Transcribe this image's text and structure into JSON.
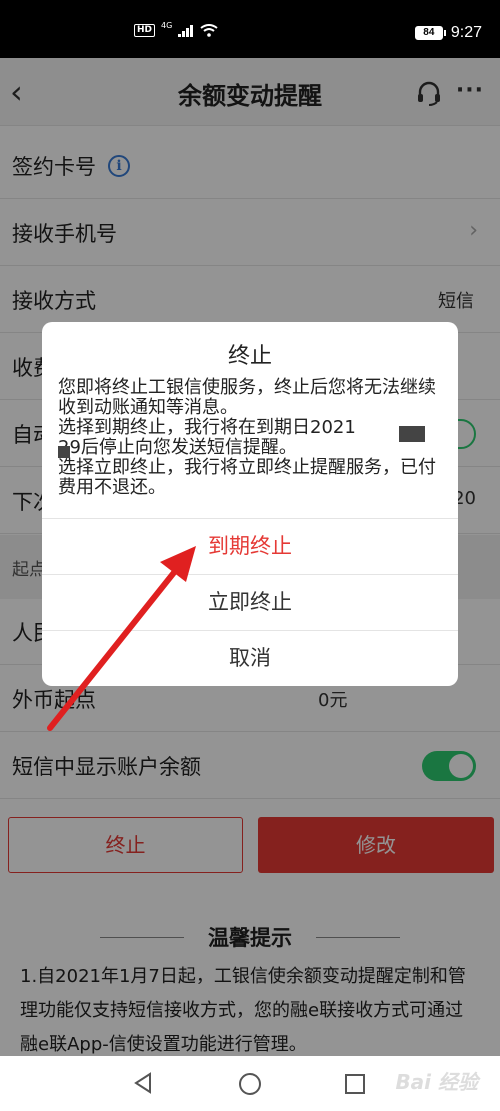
{
  "status_bar": {
    "hd": "HD",
    "network": "4G",
    "battery": "84",
    "time": "9:27"
  },
  "nav": {
    "back_icon": "‹",
    "title": "余额变动提醒",
    "more_icon": "···"
  },
  "rows": {
    "card": {
      "label": "签约卡号"
    },
    "phone": {
      "label": "接收手机号"
    },
    "method": {
      "label": "接收方式",
      "value": "短信"
    },
    "fee": {
      "label": "收费"
    },
    "auto": {
      "label": "自动"
    },
    "next": {
      "label": "下次",
      "value": "20"
    },
    "section": {
      "label": "起点"
    },
    "rmb": {
      "label": "人民"
    },
    "foreign": {
      "label": "外币起点",
      "value": "0元"
    },
    "show_balance": {
      "label": "短信中显示账户余额"
    }
  },
  "buttons": {
    "terminate": "终止",
    "modify": "修改"
  },
  "tips": {
    "title": "温馨提示",
    "text": "1.自2021年1月7日起，工银信使余额变动提醒定制和管理功能仅支持短信接收方式，您的融e联接收方式可通过融e联App-信使设置功能进行管理。"
  },
  "dialog": {
    "title": "终止",
    "line1": "您即将终止工银信使服务，终止后您将无法继续收到动账通知等消息。",
    "line2": "选择到期终止，我行将在到期日2021",
    "line3": "29后停止向您发送短信提醒。",
    "line4": "选择立即终止，我行将立即终止提醒服务，已付费用不退还。",
    "btn_expire": "到期终止",
    "btn_now": "立即终止",
    "btn_cancel": "取消"
  },
  "watermark": "Bai 经验",
  "colors": {
    "accent_red": "#e53935",
    "toggle_green": "#2ecc71",
    "info_blue": "#3a7bd5"
  }
}
